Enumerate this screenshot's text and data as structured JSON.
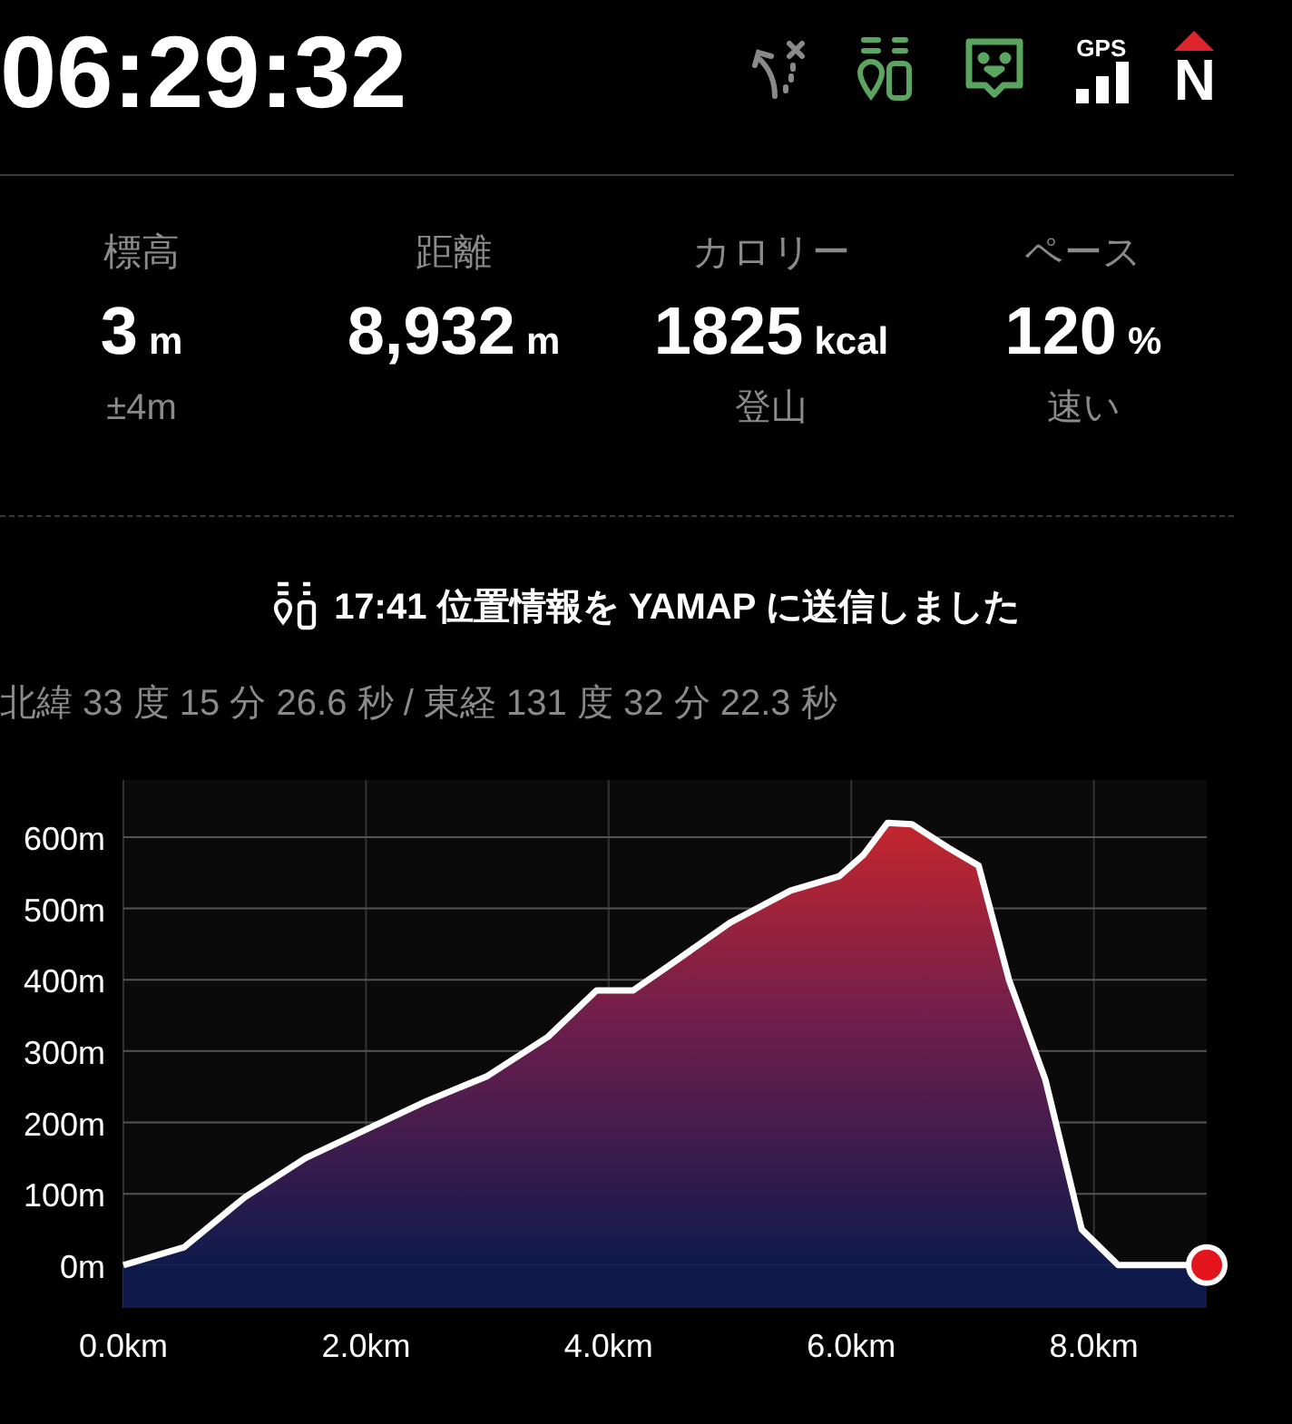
{
  "clock": "06:29:32",
  "status_icons": [
    {
      "kind": "route"
    },
    {
      "kind": "sync"
    },
    {
      "kind": "chat"
    },
    {
      "kind": "gps",
      "label": "GPS"
    },
    {
      "kind": "compass",
      "label": "N"
    }
  ],
  "stats": [
    {
      "label": "標高",
      "value": "3",
      "unit": "m",
      "sub": "±4m"
    },
    {
      "label": "距離",
      "value": "8,932",
      "unit": "m"
    },
    {
      "label": "カロリー",
      "value": "1825",
      "unit": "kcal",
      "sub": "登山"
    },
    {
      "label": "ペース",
      "value": "120",
      "unit": "%",
      "sub": "速い"
    }
  ],
  "sync_message": "17:41 位置情報を YAMAP に送信しました",
  "coordinates": "北緯 33 度 15 分 26.6 秒 / 東経 131 度 32 分 22.3 秒",
  "elevation_chart": {
    "chart_data": {
      "type": "area",
      "grid": true,
      "xlim": [
        0,
        8.93
      ],
      "ylim": [
        -60,
        680
      ],
      "xticks": [
        {
          "value": 0,
          "label": "0.0km"
        },
        {
          "value": 2,
          "label": "2.0km"
        },
        {
          "value": 4,
          "label": "4.0km"
        },
        {
          "value": 6,
          "label": "6.0km"
        },
        {
          "value": 8,
          "label": "8.0km"
        }
      ],
      "yticks": [
        {
          "value": 0,
          "label": "0m"
        },
        {
          "value": 100,
          "label": "100m"
        },
        {
          "value": 200,
          "label": "200m"
        },
        {
          "value": 300,
          "label": "300m"
        },
        {
          "value": 400,
          "label": "400m"
        },
        {
          "value": 500,
          "label": "500m"
        },
        {
          "value": 600,
          "label": "600m"
        }
      ],
      "x": [
        0,
        0.5,
        1,
        1.5,
        2,
        2.5,
        3,
        3.5,
        3.9,
        4.2,
        4.5,
        5,
        5.5,
        5.9,
        6.1,
        6.3,
        6.5,
        6.8,
        7.05,
        7.3,
        7.6,
        7.9,
        8.2,
        8.93
      ],
      "series": [
        {
          "color": "#ffffff",
          "values": [
            0,
            25,
            95,
            150,
            190,
            230,
            265,
            320,
            385,
            385,
            420,
            480,
            525,
            545,
            575,
            620,
            618,
            585,
            560,
            400,
            260,
            50,
            0,
            0
          ]
        }
      ]
    }
  }
}
